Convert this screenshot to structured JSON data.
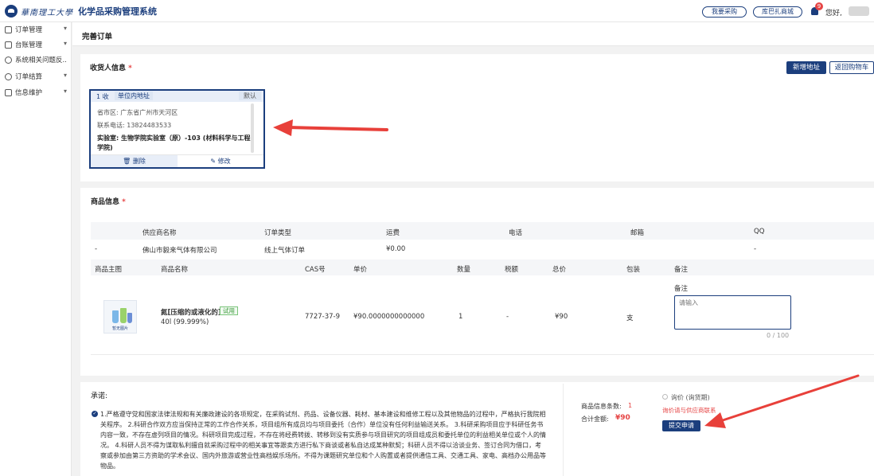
{
  "header": {
    "logo_script": "華南理工大學",
    "system_title": "化学品采购管理系统",
    "buttons": [
      "我要采购",
      "库巴扎商城"
    ],
    "notification_count": "9",
    "greeting": "您好,"
  },
  "sidebar": {
    "items": [
      {
        "label": "订单管理",
        "caret": "▾"
      },
      {
        "label": "台账管理",
        "caret": "▾"
      },
      {
        "label": "系统相关问题反...",
        "caret": ""
      },
      {
        "label": "订单结算",
        "caret": "▾"
      },
      {
        "label": "信息维护",
        "caret": "▾"
      }
    ]
  },
  "page": {
    "title": "完善订单"
  },
  "receiver": {
    "title": "收货人信息",
    "required": "*",
    "add_button": "新增地址",
    "back_button": "返回购物车",
    "card": {
      "index": "1 收",
      "tag": "单位内地址",
      "default": "默认",
      "province_line": "省市区:  广东省广州市天河区",
      "phone_line": "联系电话:  13824483533",
      "lab_line": "实验室:  生物学院实验室（原）-103 (材料科学与工程学院)",
      "delete": "删除",
      "edit": "修改"
    }
  },
  "goods": {
    "title": "商品信息",
    "required": "*",
    "supplier_headers": [
      "供应商名称",
      "订单类型",
      "运费",
      "电话",
      "邮箱",
      "QQ"
    ],
    "supplier_row": {
      "toggle": "-",
      "name": "佛山市毅来气体有限公司",
      "order_type": "线上气体订单",
      "freight": "¥0.00",
      "phone": "",
      "email": "",
      "qq": "-"
    },
    "product_headers": [
      "商品主图",
      "商品名称",
      "CAS号",
      "单价",
      "数量",
      "税额",
      "总价",
      "包装",
      "备注"
    ],
    "product": {
      "image_caption": "暂无图片",
      "name": "氮[压缩的或液化的]",
      "trial_tag": "试用",
      "spec": "40l (99.999%)",
      "cas": "7727-37-9",
      "price": "¥90.0000000000000",
      "qty": "1",
      "tax": "-",
      "total": "¥90",
      "package": "支",
      "remark_label": "备注",
      "remark_placeholder": "请输入",
      "counter": "0 / 100"
    }
  },
  "promise": {
    "title": "承诺:",
    "text": "1.严格遵守党和国家法律法规和有关廉政建设的各项规定，在采购试剂、药品、设备仪器、耗材、基本建设和维修工程以及其他物品的过程中，严格执行我院相关程序。 2.科研合作双方应当保持正常的工作合作关系，项目组所有成员均与项目委托（合作）单位没有任何利益输送关系。 3.科研采购项目应于科研任务书内容一致，不存在虚列项目的情况。科研项目完成过程，不存在将经费转拨、转移到没有实质参与项目研究的项目组成员和委托单位的利益相关单位或个人的情况。 4.科研人员不得为谋取私利擅自就采购过程中的相关事宜等跟卖方进行私下商谈或者私自达成某种默契；科研人员不得以洽谈业务、签订合同为借口，考察或参加由第三方资助的学术会议、国内外旅游或营业性高档娱乐场所。不得为课题研究单位和个人购置或者提供通信工具、交通工具、家电、高档办公用品等物品。"
  },
  "summary": {
    "count_label": "商品信息条数:",
    "count_value": "1",
    "total_label": "合计金额:",
    "total_value": "¥90",
    "inquiry_label": "询价 (询货期)",
    "inquiry_note": "询价请与供应商联系",
    "submit": "提交申请"
  },
  "colors": {
    "brand": "#1b3e7d",
    "arrow": "#e8403a",
    "required": "#e64545"
  }
}
